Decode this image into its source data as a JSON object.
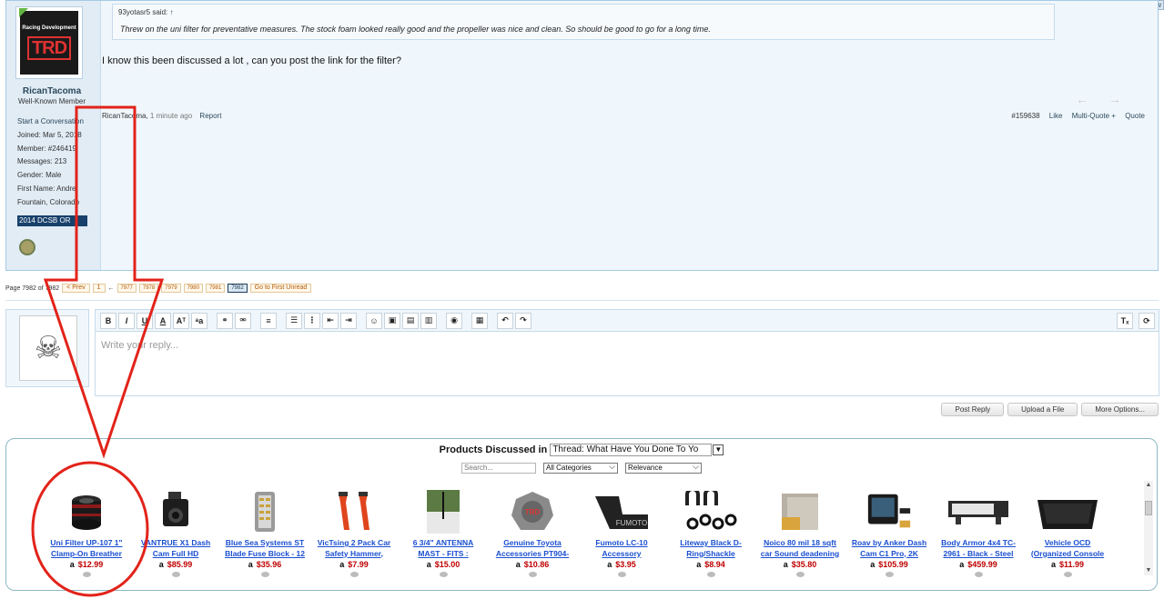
{
  "new_tab_label": "New",
  "post": {
    "author": {
      "avatar_line1": "Racing Development",
      "avatar_line2": "TRD",
      "username": "RicanTacoma",
      "title": "Well-Known Member",
      "start_conversation": "Start a Conversation",
      "joined": "Joined: Mar 5, 2018",
      "member": "Member: #246419",
      "messages": "Messages: 213",
      "gender": "Gender: Male",
      "first_name": "First Name: Andre",
      "location": "Fountain, Colorado",
      "badge": "2014 DCSB OR"
    },
    "quote": {
      "said": "93yotasr5 said:",
      "arrow": "↑",
      "text": "Threw on the uni filter for preventative measures. The stock foam looked really good and the propeller was nice and clean. So should be good to go for a long time."
    },
    "message": "I know this been discussed a lot , can you post the link for the filter?",
    "meta": {
      "author": "RicanTacoma,",
      "time": "1 minute ago",
      "report": "Report",
      "number": "#159638",
      "like": "Like",
      "multiquote": "Multi-Quote +",
      "quote": "Quote"
    }
  },
  "pager": {
    "label": "Page 7982 of 7982",
    "prev": "< Prev",
    "first": "1",
    "ellipsis": "←",
    "pages": [
      "7977",
      "7978",
      "7979",
      "7980",
      "7981",
      "7982"
    ],
    "first_unread": "Go to First Unread"
  },
  "editor": {
    "placeholder": "Write your reply..."
  },
  "reply_buttons": {
    "post": "Post Reply",
    "upload": "Upload a File",
    "more": "More Options..."
  },
  "products": {
    "heading": "Products Discussed in",
    "thread_select": "Thread: What Have You Done To Yo",
    "search_placeholder": "Search...",
    "category": "All Categories",
    "sort": "Relevance",
    "items": [
      {
        "name": "Uni Filter UP-107 1\" Clamp-On Breather",
        "price": "$12.99"
      },
      {
        "name": "VANTRUE X1 Dash Cam Full HD",
        "price": "$85.99"
      },
      {
        "name": "Blue Sea Systems ST Blade Fuse Block - 12",
        "price": "$35.96"
      },
      {
        "name": "VicTsing 2 Pack Car Safety Hammer,",
        "price": "$7.99"
      },
      {
        "name": "6 3/4\" ANTENNA MAST - FITS :",
        "price": "$15.00"
      },
      {
        "name": "Genuine Toyota Accessories PT904-",
        "price": "$10.86"
      },
      {
        "name": "Fumoto LC-10 Accessory",
        "price": "$3.95"
      },
      {
        "name": "Liteway Black D-Ring/Shackle",
        "price": "$8.94"
      },
      {
        "name": "Noico 80 mil 18 sqft car Sound deadening",
        "price": "$35.80"
      },
      {
        "name": "Roav by Anker Dash Cam C1 Pro, 2K",
        "price": "$105.99"
      },
      {
        "name": "Body Armor 4x4 TC-2961 - Black - Steel",
        "price": "$459.99"
      },
      {
        "name": "Vehicle OCD (Organized Console",
        "price": "$11.99"
      }
    ]
  },
  "colors": {
    "annotation_red": "#e2231a",
    "link_blue": "#1a4fd0",
    "price_red": "#c00000"
  }
}
